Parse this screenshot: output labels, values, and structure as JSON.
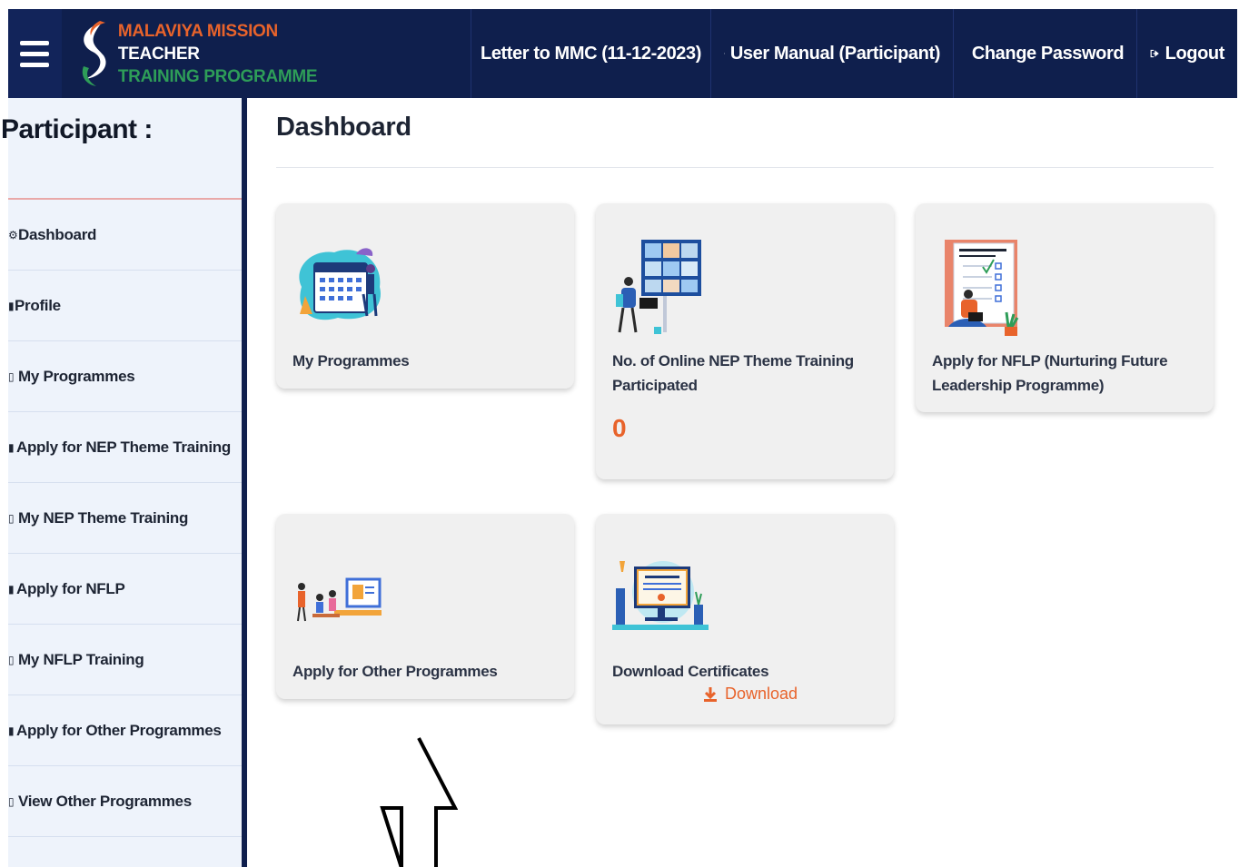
{
  "brand": {
    "line1": "MALAVIYA MISSION",
    "line2": "TEACHER",
    "line3": "TRAINING PROGRAMME"
  },
  "nav": {
    "letter": "Letter to MMC (11-12-2023)",
    "manual": "User Manual (Participant)",
    "password": "Change Password",
    "logout": "Logout"
  },
  "sidebar": {
    "participant_label": "Participant :",
    "items": [
      {
        "label": "Dashboard"
      },
      {
        "label": "Profile"
      },
      {
        "label": "My Programmes"
      },
      {
        "label": "Apply for NEP Theme Training"
      },
      {
        "label": "My NEP Theme Training"
      },
      {
        "label": "Apply for NFLP"
      },
      {
        "label": "My NFLP Training"
      },
      {
        "label": "Apply for Other Programmes"
      },
      {
        "label": "View Other Programmes"
      }
    ]
  },
  "main": {
    "title": "Dashboard",
    "cards": {
      "my_programmes": {
        "label": "My Programmes"
      },
      "nep_training": {
        "label_l1": "No. of Online NEP Theme Training",
        "label_l2": "Participated",
        "count": "0"
      },
      "nflp": {
        "label_l1": "Apply for NFLP (Nurturing Future",
        "label_l2": "Leadership Programme)"
      },
      "other_programmes": {
        "label": "Apply for Other Programmes"
      },
      "certificates": {
        "label": "Download Certificates",
        "download": "Download"
      }
    }
  },
  "colors": {
    "navy": "#0f1f4d",
    "accent": "#e8632b",
    "green": "#2e9d58",
    "sidebar_bg": "#eef3fb",
    "card_bg": "#f0f0f0"
  }
}
